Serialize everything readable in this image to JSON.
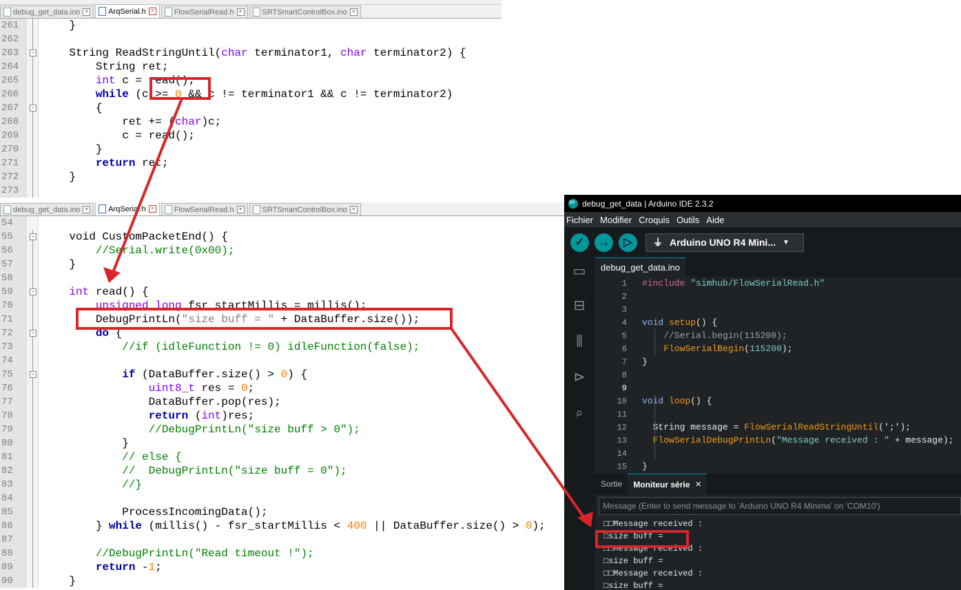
{
  "top_editor": {
    "tabs": [
      {
        "label": "debug_get_data.ino",
        "active": false
      },
      {
        "label": "ArqSerial.h",
        "active": true
      },
      {
        "label": "FlowSerialRead.h",
        "active": false
      },
      {
        "label": "SRTSmartControlBox.ino",
        "active": false
      }
    ],
    "lines": [
      {
        "num": "261",
        "fold": "line",
        "parts": [
          {
            "t": "    }",
            "c": ""
          }
        ]
      },
      {
        "num": "262",
        "fold": "line",
        "parts": []
      },
      {
        "num": "263",
        "fold": "box",
        "parts": [
          {
            "t": "    String ReadStringUntil(",
            "c": ""
          },
          {
            "t": "char",
            "c": "ty"
          },
          {
            "t": " terminator1, ",
            "c": ""
          },
          {
            "t": "char",
            "c": "ty"
          },
          {
            "t": " terminator2) {",
            "c": ""
          }
        ]
      },
      {
        "num": "264",
        "fold": "line",
        "parts": [
          {
            "t": "        String ret;",
            "c": ""
          }
        ]
      },
      {
        "num": "265",
        "fold": "line",
        "parts": [
          {
            "t": "        ",
            "c": ""
          },
          {
            "t": "int",
            "c": "ty"
          },
          {
            "t": " c = read();",
            "c": ""
          }
        ]
      },
      {
        "num": "266",
        "fold": "line",
        "parts": [
          {
            "t": "        ",
            "c": ""
          },
          {
            "t": "while",
            "c": "kw"
          },
          {
            "t": " (c >= ",
            "c": ""
          },
          {
            "t": "0",
            "c": "num"
          },
          {
            "t": " && c != terminator1 && c != terminator2)",
            "c": ""
          }
        ]
      },
      {
        "num": "267",
        "fold": "box",
        "parts": [
          {
            "t": "        {",
            "c": ""
          }
        ]
      },
      {
        "num": "268",
        "fold": "line",
        "parts": [
          {
            "t": "            ret += (",
            "c": ""
          },
          {
            "t": "char",
            "c": "ty"
          },
          {
            "t": ")c;",
            "c": ""
          }
        ]
      },
      {
        "num": "269",
        "fold": "line",
        "parts": [
          {
            "t": "            c = read();",
            "c": ""
          }
        ]
      },
      {
        "num": "270",
        "fold": "line",
        "parts": [
          {
            "t": "        }",
            "c": ""
          }
        ]
      },
      {
        "num": "271",
        "fold": "line",
        "parts": [
          {
            "t": "        ",
            "c": ""
          },
          {
            "t": "return",
            "c": "kw"
          },
          {
            "t": " ret;",
            "c": ""
          }
        ]
      },
      {
        "num": "272",
        "fold": "line",
        "parts": [
          {
            "t": "    }",
            "c": ""
          }
        ]
      },
      {
        "num": "273",
        "fold": "line",
        "parts": []
      }
    ]
  },
  "bottom_editor": {
    "tabs": [
      {
        "label": "debug_get_data.ino",
        "active": false
      },
      {
        "label": "ArqSerial.h",
        "active": true
      },
      {
        "label": "FlowSerialRead.h",
        "active": false
      },
      {
        "label": "SRTSmartControlBox.ino",
        "active": false
      }
    ],
    "lines": [
      {
        "num": "54",
        "fold": "none",
        "parts": []
      },
      {
        "num": "55",
        "fold": "box",
        "parts": [
          {
            "t": "    void CustomPacketEnd() {",
            "c": ""
          }
        ]
      },
      {
        "num": "56",
        "fold": "line",
        "parts": [
          {
            "t": "        //Serial.write(0x00);",
            "c": "cm"
          }
        ]
      },
      {
        "num": "57",
        "fold": "line",
        "parts": [
          {
            "t": "    }",
            "c": ""
          }
        ]
      },
      {
        "num": "58",
        "fold": "line",
        "parts": []
      },
      {
        "num": "59",
        "fold": "box",
        "parts": [
          {
            "t": "    int",
            "c": "ty"
          },
          {
            "t": " read() {",
            "c": ""
          }
        ]
      },
      {
        "num": "70",
        "fold": "line",
        "parts": [
          {
            "t": "        ",
            "c": ""
          },
          {
            "t": "unsigned long",
            "c": "ty"
          },
          {
            "t": " fsr_startMillis = millis();",
            "c": ""
          }
        ]
      },
      {
        "num": "71",
        "fold": "line",
        "parts": [
          {
            "t": "        DebugPrintLn(",
            "c": ""
          },
          {
            "t": "\"size buff = \"",
            "c": "str"
          },
          {
            "t": " + DataBuffer.size());",
            "c": ""
          }
        ]
      },
      {
        "num": "72",
        "fold": "box",
        "parts": [
          {
            "t": "        ",
            "c": ""
          },
          {
            "t": "do",
            "c": "kw"
          },
          {
            "t": " {",
            "c": ""
          }
        ]
      },
      {
        "num": "73",
        "fold": "line",
        "parts": [
          {
            "t": "            //if (idleFunction != 0) idleFunction(false);",
            "c": "cm"
          }
        ]
      },
      {
        "num": "74",
        "fold": "line",
        "parts": []
      },
      {
        "num": "75",
        "fold": "box",
        "parts": [
          {
            "t": "            ",
            "c": ""
          },
          {
            "t": "if",
            "c": "kw"
          },
          {
            "t": " (DataBuffer.size() > ",
            "c": ""
          },
          {
            "t": "0",
            "c": "num"
          },
          {
            "t": ") {",
            "c": ""
          }
        ]
      },
      {
        "num": "76",
        "fold": "line",
        "parts": [
          {
            "t": "                ",
            "c": ""
          },
          {
            "t": "uint8_t",
            "c": "ty"
          },
          {
            "t": " res = ",
            "c": ""
          },
          {
            "t": "0",
            "c": "num"
          },
          {
            "t": ";",
            "c": ""
          }
        ]
      },
      {
        "num": "77",
        "fold": "line",
        "parts": [
          {
            "t": "                DataBuffer.pop(res);",
            "c": ""
          }
        ]
      },
      {
        "num": "78",
        "fold": "line",
        "parts": [
          {
            "t": "                ",
            "c": ""
          },
          {
            "t": "return",
            "c": "kw"
          },
          {
            "t": " (",
            "c": ""
          },
          {
            "t": "int",
            "c": "ty"
          },
          {
            "t": ")res;",
            "c": ""
          }
        ]
      },
      {
        "num": "79",
        "fold": "line",
        "parts": [
          {
            "t": "                //DebugPrintLn(\"size buff > 0\");",
            "c": "cm"
          }
        ]
      },
      {
        "num": "80",
        "fold": "line",
        "parts": [
          {
            "t": "            }",
            "c": ""
          }
        ]
      },
      {
        "num": "81",
        "fold": "line",
        "parts": [
          {
            "t": "            // else {",
            "c": "cm"
          }
        ]
      },
      {
        "num": "82",
        "fold": "line",
        "parts": [
          {
            "t": "            //  DebugPrintLn(\"size buff = 0\");",
            "c": "cm"
          }
        ]
      },
      {
        "num": "83",
        "fold": "line",
        "parts": [
          {
            "t": "            //}",
            "c": "cm"
          }
        ]
      },
      {
        "num": "84",
        "fold": "line",
        "parts": []
      },
      {
        "num": "85",
        "fold": "line",
        "parts": [
          {
            "t": "            ProcessIncomingData();",
            "c": ""
          }
        ]
      },
      {
        "num": "86",
        "fold": "line",
        "parts": [
          {
            "t": "        } ",
            "c": ""
          },
          {
            "t": "while",
            "c": "kw"
          },
          {
            "t": " (millis() - fsr_startMillis < ",
            "c": ""
          },
          {
            "t": "400",
            "c": "num"
          },
          {
            "t": " || DataBuffer.size() > ",
            "c": ""
          },
          {
            "t": "0",
            "c": "num"
          },
          {
            "t": ");",
            "c": ""
          }
        ]
      },
      {
        "num": "87",
        "fold": "line",
        "parts": []
      },
      {
        "num": "88",
        "fold": "line",
        "parts": [
          {
            "t": "        //DebugPrintLn(\"Read timeout !\");",
            "c": "cm"
          }
        ]
      },
      {
        "num": "89",
        "fold": "line",
        "parts": [
          {
            "t": "        ",
            "c": ""
          },
          {
            "t": "return",
            "c": "kw"
          },
          {
            "t": " -",
            "c": ""
          },
          {
            "t": "1",
            "c": "num"
          },
          {
            "t": ";",
            "c": ""
          }
        ]
      },
      {
        "num": "90",
        "fold": "line",
        "parts": [
          {
            "t": "    }",
            "c": ""
          }
        ]
      }
    ]
  },
  "ide": {
    "title": "debug_get_data | Arduino IDE 2.3.2",
    "menu": [
      "Fichier",
      "Modifier",
      "Croquis",
      "Outils",
      "Aide"
    ],
    "board": "Arduino UNO R4 Mini...",
    "file_tab": "debug_get_data.ino",
    "lines": [
      {
        "num": "1",
        "parts": [
          {
            "t": "#include ",
            "c": "ipp"
          },
          {
            "t": "\"simhub/FlowSerialRead.h\"",
            "c": "istr"
          }
        ]
      },
      {
        "num": "2",
        "parts": []
      },
      {
        "num": "3",
        "parts": []
      },
      {
        "num": "4",
        "parts": [
          {
            "t": "void",
            "c": "ikw"
          },
          {
            "t": " ",
            "c": ""
          },
          {
            "t": "setup",
            "c": "ifn"
          },
          {
            "t": "() {",
            "c": ""
          }
        ]
      },
      {
        "num": "5",
        "parts": [
          {
            "t": "    //Serial.begin(115200);",
            "c": "icm"
          }
        ]
      },
      {
        "num": "6",
        "parts": [
          {
            "t": "    ",
            "c": ""
          },
          {
            "t": "FlowSerialBegin",
            "c": "ifn"
          },
          {
            "t": "(",
            "c": ""
          },
          {
            "t": "115200",
            "c": "inum"
          },
          {
            "t": ");",
            "c": ""
          }
        ]
      },
      {
        "num": "7",
        "parts": [
          {
            "t": "}",
            "c": ""
          }
        ]
      },
      {
        "num": "8",
        "parts": []
      },
      {
        "num": "9",
        "parts": [],
        "current": true
      },
      {
        "num": "10",
        "parts": [
          {
            "t": "void",
            "c": "ikw"
          },
          {
            "t": " ",
            "c": ""
          },
          {
            "t": "loop",
            "c": "ifn"
          },
          {
            "t": "() {",
            "c": ""
          }
        ]
      },
      {
        "num": "11",
        "parts": []
      },
      {
        "num": "12",
        "parts": [
          {
            "t": "  String message = ",
            "c": ""
          },
          {
            "t": "FlowSerialReadStringUntil",
            "c": "ifn"
          },
          {
            "t": "(';');",
            "c": ""
          }
        ]
      },
      {
        "num": "13",
        "parts": [
          {
            "t": "  ",
            "c": ""
          },
          {
            "t": "FlowSerialDebugPrintLn",
            "c": "ifn"
          },
          {
            "t": "(",
            "c": ""
          },
          {
            "t": "\"Message received : \"",
            "c": "istr"
          },
          {
            "t": " + message);",
            "c": ""
          }
        ]
      },
      {
        "num": "14",
        "parts": []
      },
      {
        "num": "15",
        "parts": [
          {
            "t": "}",
            "c": ""
          }
        ]
      }
    ],
    "panel_tabs": {
      "output": "Sortie",
      "serial_monitor": "Moniteur série"
    },
    "message_placeholder": "Message (Enter to send message to 'Arduino UNO R4 Minima' on 'COM10')",
    "serial_output": [
      "□□Message received :",
      "□size buff =",
      "□□Message received :",
      "□size buff =",
      "□□Message received :",
      "□size buff ="
    ]
  },
  "annotation_color": "#d8262a"
}
